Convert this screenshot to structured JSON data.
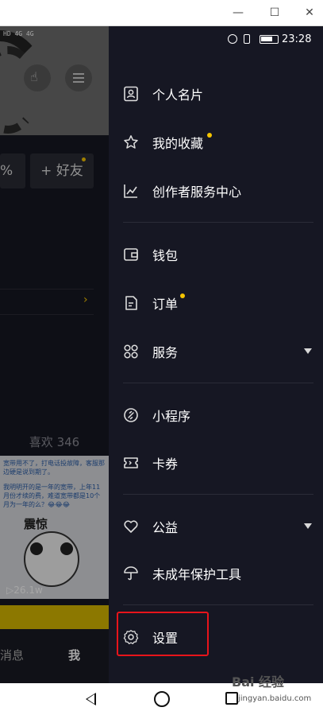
{
  "window": {
    "minimize_glyph": "—",
    "maximize_glyph": "☐",
    "close_glyph": "✕"
  },
  "status_bar": {
    "time": "23:28",
    "left_status_text": "HD 4G 4G"
  },
  "background_profile": {
    "pill_left_text": "%",
    "add_friend_label": "+ 好友",
    "likes_label": "喜欢 346",
    "thumb_text_1": "宽带用不了，打电话投故障，客服那边硬是说到期了。",
    "thumb_text_2": "我明明开的是一年的宽带，上年11月份才续的费，难道宽带都是10个月为一年的么？😂😂😂",
    "thumb_big_text": "震惊",
    "thumb_views": "▷26.1w",
    "tab_messages": "消息",
    "tab_me": "我"
  },
  "drawer": {
    "items": [
      {
        "label": "个人名片",
        "icon": "id-card-icon",
        "has_dot": false,
        "has_arrow": false
      },
      {
        "label": "我的收藏",
        "icon": "star-icon",
        "has_dot": true,
        "has_arrow": false
      },
      {
        "label": "创作者服务中心",
        "icon": "chart-line-icon",
        "has_dot": false,
        "has_arrow": false
      },
      {
        "label": "钱包",
        "icon": "wallet-icon",
        "has_dot": false,
        "has_arrow": false
      },
      {
        "label": "订单",
        "icon": "order-icon",
        "has_dot": true,
        "has_arrow": false
      },
      {
        "label": "服务",
        "icon": "grid-icon",
        "has_dot": false,
        "has_arrow": true
      },
      {
        "label": "小程序",
        "icon": "link-icon",
        "has_dot": false,
        "has_arrow": false
      },
      {
        "label": "卡券",
        "icon": "ticket-icon",
        "has_dot": false,
        "has_arrow": false
      },
      {
        "label": "公益",
        "icon": "heart-icon",
        "has_dot": false,
        "has_arrow": true
      },
      {
        "label": "未成年保护工具",
        "icon": "umbrella-icon",
        "has_dot": false,
        "has_arrow": false
      },
      {
        "label": "设置",
        "icon": "gear-icon",
        "has_dot": false,
        "has_arrow": false
      }
    ],
    "accent_dot_color": "#f5c400",
    "highlight_color": "#e8141b"
  },
  "watermark": {
    "brand": "Bai 经验",
    "url": "jingyan.baidu.com"
  }
}
